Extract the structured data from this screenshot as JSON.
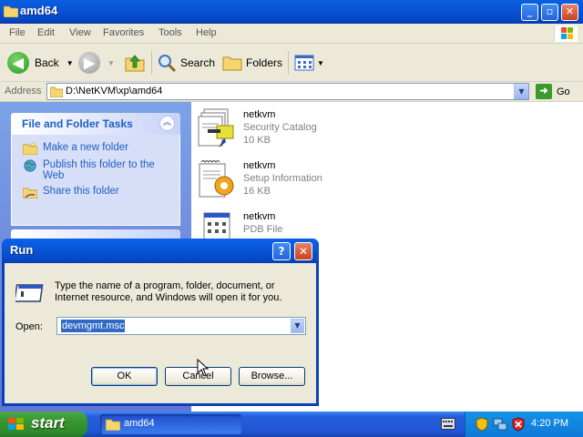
{
  "explorer": {
    "title": "amd64",
    "menu": [
      "File",
      "Edit",
      "View",
      "Favorites",
      "Tools",
      "Help"
    ],
    "toolbar": {
      "back": "Back",
      "search": "Search",
      "folders": "Folders"
    },
    "address": {
      "label": "Address",
      "path": "D:\\NetKVM\\xp\\amd64",
      "go": "Go"
    },
    "tasks": {
      "heading": "File and Folder Tasks",
      "items": [
        {
          "label": "Make a new folder",
          "icon": "new-folder-icon"
        },
        {
          "label": "Publish this folder to the Web",
          "icon": "publish-web-icon"
        },
        {
          "label": "Share this folder",
          "icon": "share-folder-icon"
        }
      ]
    },
    "files": [
      {
        "name": "netkvm",
        "type": "Security Catalog",
        "size": "10 KB",
        "icon": "security-catalog-icon"
      },
      {
        "name": "netkvm",
        "type": "Setup Information",
        "size": "16 KB",
        "icon": "setup-information-icon"
      },
      {
        "name": "netkvm",
        "type": "PDB File",
        "size": "",
        "icon": "pdb-file-icon"
      }
    ]
  },
  "run_dialog": {
    "title": "Run",
    "description": "Type the name of a program, folder, document, or Internet resource, and Windows will open it for you.",
    "open_label": "Open:",
    "open_value": "devmgmt.msc",
    "ok": "OK",
    "cancel": "Cancel",
    "browse": "Browse..."
  },
  "taskbar": {
    "start": "start",
    "window_button": "amd64",
    "clock": "4:20 PM"
  },
  "colors": {
    "titlebar_blue": "#0a54d6",
    "taskpane_blue": "#6375d6",
    "start_green": "#3a9a34",
    "link_blue": "#215dc6"
  }
}
